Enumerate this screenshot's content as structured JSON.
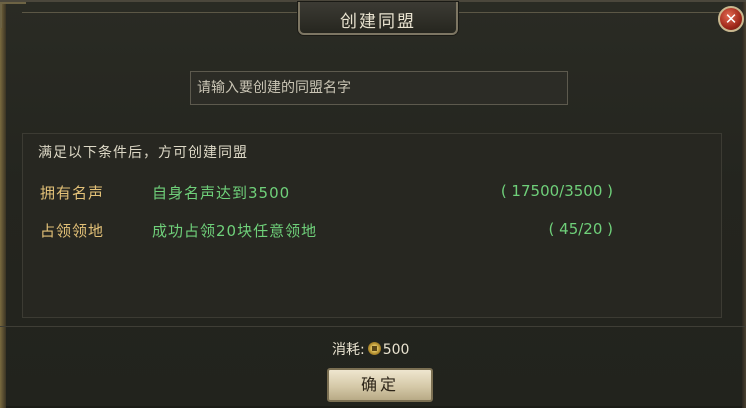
{
  "dialog": {
    "title": "创建同盟",
    "close_symbol": "✕"
  },
  "input": {
    "placeholder": "请输入要创建的同盟名字",
    "value": ""
  },
  "requirements": {
    "header": "满足以下条件后，方可创建同盟",
    "items": [
      {
        "label": "拥有名声",
        "description": "自身名声达到3500",
        "progress": "( 17500/3500 )"
      },
      {
        "label": "占领领地",
        "description": "成功占领20块任意领地",
        "progress": "( 45/20 )"
      }
    ]
  },
  "cost": {
    "label": "消耗:",
    "icon": "coin-icon",
    "amount": "500"
  },
  "confirm_label": "确定",
  "colors": {
    "condition_label": "#e3c178",
    "condition_text": "#6fd07a",
    "close_button": "#c23b27"
  }
}
